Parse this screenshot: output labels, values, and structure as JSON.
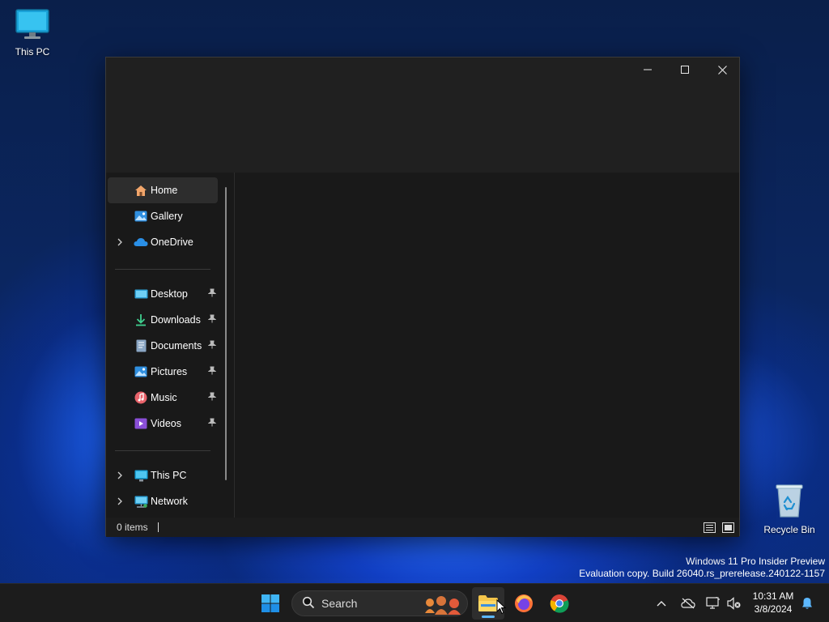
{
  "desktop": {
    "icons": [
      {
        "label": "This PC",
        "icon": "monitor-icon"
      },
      {
        "label": "Recycle Bin",
        "icon": "recycle-bin-icon"
      }
    ],
    "watermark": {
      "line1": "Windows 11 Pro Insider Preview",
      "line2": "Evaluation copy. Build 26040.rs_prerelease.240122-1157"
    }
  },
  "window": {
    "caption_buttons": [
      "minimize",
      "maximize",
      "close"
    ],
    "nav": {
      "quick": [
        {
          "label": "Home",
          "icon": "home-icon",
          "selected": true,
          "expandable": false
        },
        {
          "label": "Gallery",
          "icon": "gallery-icon",
          "selected": false,
          "expandable": false
        },
        {
          "label": "OneDrive",
          "icon": "cloud-icon",
          "selected": false,
          "expandable": true
        }
      ],
      "pinned": [
        {
          "label": "Desktop",
          "icon": "desktop-folder-icon"
        },
        {
          "label": "Downloads",
          "icon": "download-icon"
        },
        {
          "label": "Documents",
          "icon": "document-icon"
        },
        {
          "label": "Pictures",
          "icon": "pictures-icon"
        },
        {
          "label": "Music",
          "icon": "music-icon"
        },
        {
          "label": "Videos",
          "icon": "videos-icon"
        }
      ],
      "devices": [
        {
          "label": "This PC",
          "icon": "monitor-icon"
        },
        {
          "label": "Network",
          "icon": "network-icon"
        }
      ]
    },
    "status": {
      "items_text": "0 items"
    }
  },
  "taskbar": {
    "search_label": "Search",
    "apps": [
      "start-icon",
      "file-explorer-icon",
      "firefox-icon",
      "chrome-icon"
    ],
    "active_app": "file-explorer-icon",
    "tray": [
      "chevron-up-icon",
      "onedrive-offline-icon",
      "network-icon",
      "volume-muted-icon",
      "notification-bell-icon"
    ],
    "clock": {
      "time": "10:31 AM",
      "date": "3/8/2024"
    }
  },
  "colors": {
    "accent": "#5cb8ff",
    "window_bg": "#191919",
    "taskbar_bg": "#1c1c1c"
  }
}
